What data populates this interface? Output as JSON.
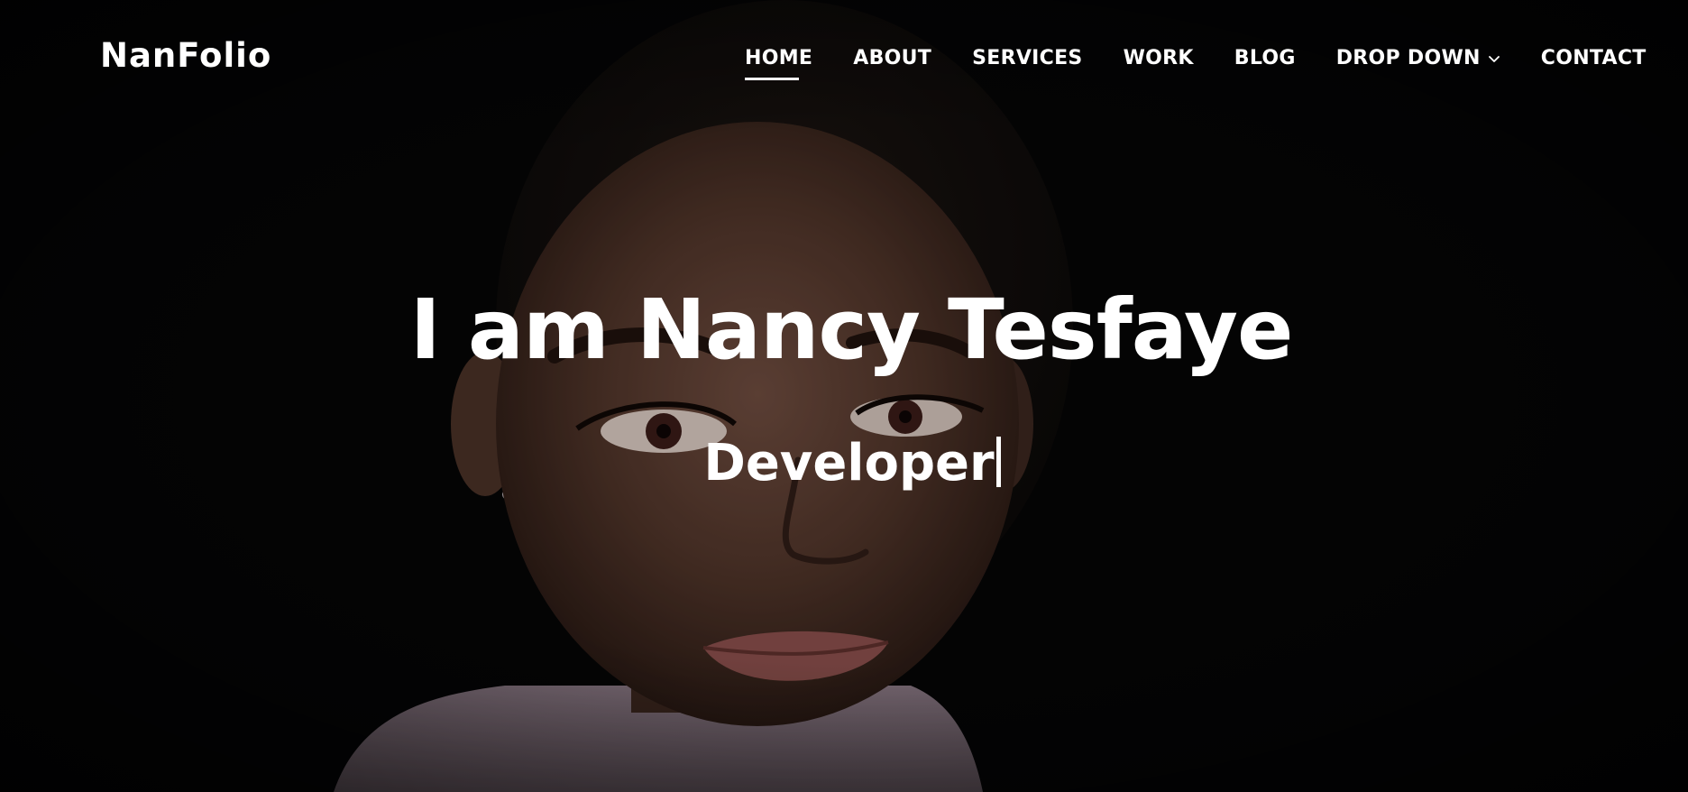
{
  "brand": {
    "logo_text": "NanFolio"
  },
  "nav": {
    "items": [
      {
        "label": "HOME",
        "active": true
      },
      {
        "label": "ABOUT",
        "active": false
      },
      {
        "label": "SERVICES",
        "active": false
      },
      {
        "label": "WORK",
        "active": false
      },
      {
        "label": "BLOG",
        "active": false
      },
      {
        "label": "DROP DOWN",
        "active": false,
        "has_dropdown": true,
        "icon": "chevron-down-icon"
      },
      {
        "label": "CONTACT",
        "active": false
      }
    ]
  },
  "hero": {
    "title": "I am Nancy Tesfaye",
    "typed_text": "Developer",
    "background": "portrait-photo"
  },
  "colors": {
    "background": "#050506",
    "text": "#ffffff",
    "active_underline": "#ffffff"
  }
}
